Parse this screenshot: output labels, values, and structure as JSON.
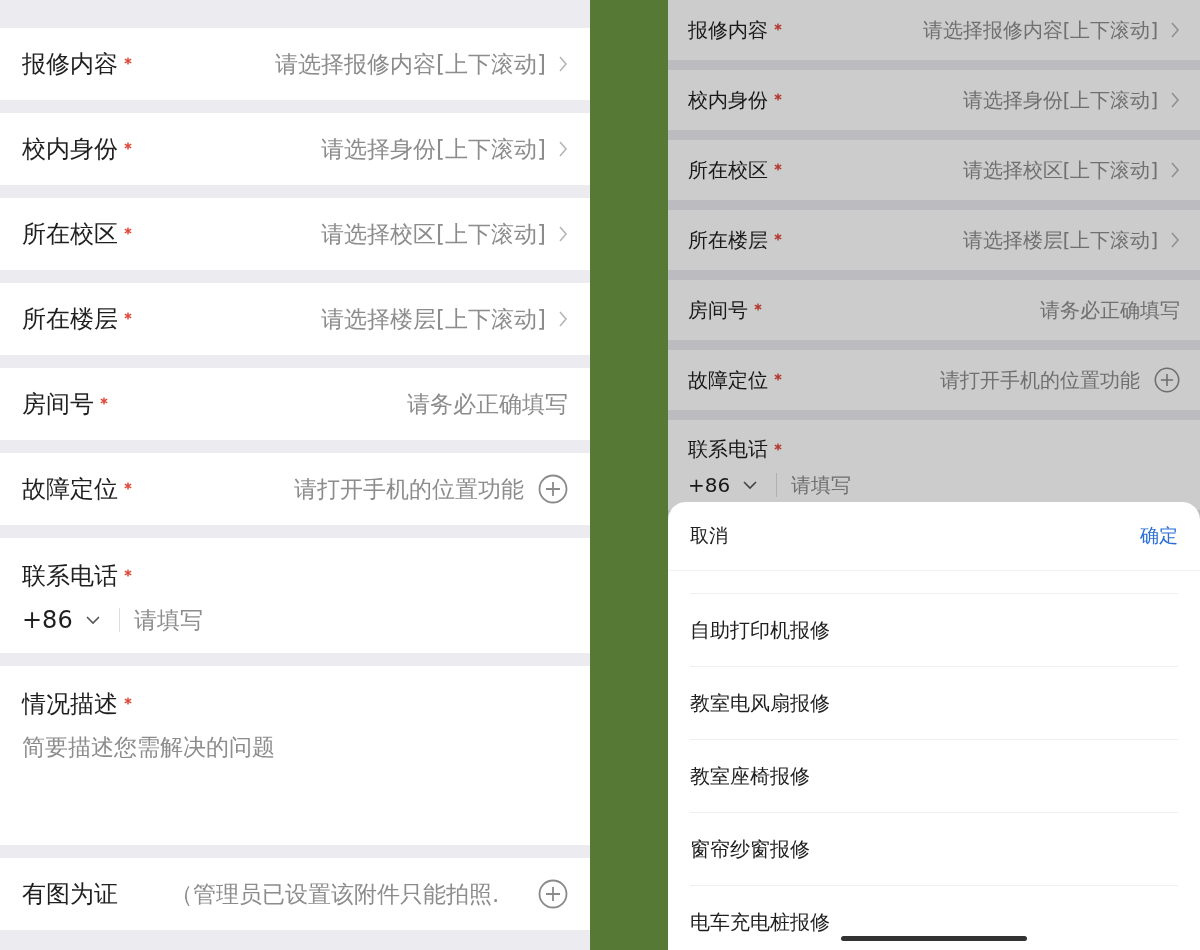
{
  "left_screen": {
    "fields": [
      {
        "kind": "select",
        "label": "报修内容",
        "required": true,
        "placeholder": "请选择报修内容[上下滚动]"
      },
      {
        "kind": "select",
        "label": "校内身份",
        "required": true,
        "placeholder": "请选择身份[上下滚动]"
      },
      {
        "kind": "select",
        "label": "所在校区",
        "required": true,
        "placeholder": "请选择校区[上下滚动]"
      },
      {
        "kind": "select",
        "label": "所在楼层",
        "required": true,
        "placeholder": "请选择楼层[上下滚动]"
      },
      {
        "kind": "text",
        "label": "房间号",
        "required": true,
        "placeholder": "请务必正确填写"
      },
      {
        "kind": "location",
        "label": "故障定位",
        "required": true,
        "hint": "请打开手机的位置功能"
      },
      {
        "kind": "phone",
        "label": "联系电话",
        "required": true,
        "country_code": "+86",
        "placeholder": "请填写"
      },
      {
        "kind": "textarea",
        "label": "情况描述",
        "required": true,
        "placeholder": "简要描述您需解决的问题"
      },
      {
        "kind": "upload",
        "label": "有图为证",
        "required": false,
        "hint": "（管理员已设置该附件只能拍照."
      }
    ]
  },
  "right_screen": {
    "fields": [
      {
        "kind": "select",
        "label": "报修内容",
        "required": true,
        "placeholder": "请选择报修内容[上下滚动]"
      },
      {
        "kind": "select",
        "label": "校内身份",
        "required": true,
        "placeholder": "请选择身份[上下滚动]"
      },
      {
        "kind": "select",
        "label": "所在校区",
        "required": true,
        "placeholder": "请选择校区[上下滚动]"
      },
      {
        "kind": "select",
        "label": "所在楼层",
        "required": true,
        "placeholder": "请选择楼层[上下滚动]"
      },
      {
        "kind": "text",
        "label": "房间号",
        "required": true,
        "placeholder": "请务必正确填写"
      },
      {
        "kind": "location",
        "label": "故障定位",
        "required": true,
        "hint": "请打开手机的位置功能"
      },
      {
        "kind": "phone",
        "label": "联系电话",
        "required": true,
        "country_code": "+86",
        "placeholder": "请填写"
      }
    ],
    "picker_sheet": {
      "cancel": "取消",
      "confirm": "确定",
      "options": [
        {
          "label": "自助打印机报修"
        },
        {
          "label": "教室电风扇报修"
        },
        {
          "label": "教室座椅报修"
        },
        {
          "label": "窗帘纱窗报修"
        },
        {
          "label": "电车充电桩报修"
        }
      ]
    }
  }
}
